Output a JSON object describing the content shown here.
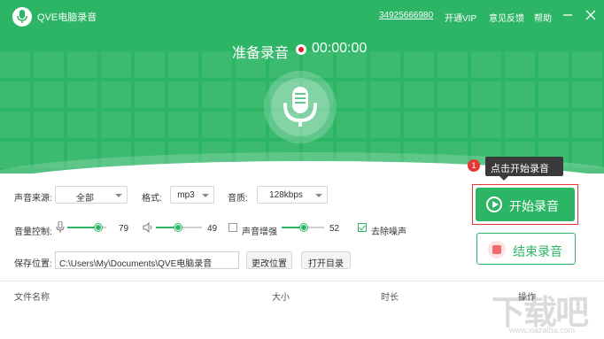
{
  "app": {
    "title": "QVE电脑录音",
    "logo_icon": "microphone-icon"
  },
  "titlebar": {
    "phone": "34925666980",
    "vip": "开通VIP",
    "feedback": "意见反馈",
    "help": "帮助",
    "minimize_icon": "minimize-icon",
    "close_icon": "close-icon"
  },
  "status": {
    "label": "准备录音",
    "time": "00:00:00"
  },
  "controls": {
    "source_label": "声音来源:",
    "source_value": "全部",
    "format_label": "格式:",
    "format_value": "mp3",
    "quality_label": "音质:",
    "quality_value": "128kbps",
    "volume_label": "音量控制:",
    "mic_volume": 79,
    "speaker_volume": 49,
    "boost_label": "声音增强",
    "boost_checked": false,
    "boost_value": 52,
    "denoise_label": "去除噪声",
    "denoise_checked": true,
    "save_label": "保存位置:",
    "save_path": "C:\\Users\\My\\Documents\\QVE电脑录音",
    "change_location": "更改位置",
    "open_folder": "打开目录"
  },
  "tooltip": {
    "badge": "1",
    "text": "点击开始录音"
  },
  "actions": {
    "start": "开始录音",
    "stop": "结束录音"
  },
  "file_list": {
    "columns": [
      "文件名称",
      "大小",
      "时长",
      "操作"
    ]
  },
  "watermark": {
    "text": "下载吧",
    "url": "www.xiazaiba.com"
  },
  "colors": {
    "brand": "#2bb564",
    "record": "#e02020",
    "highlight": "#e53935"
  }
}
